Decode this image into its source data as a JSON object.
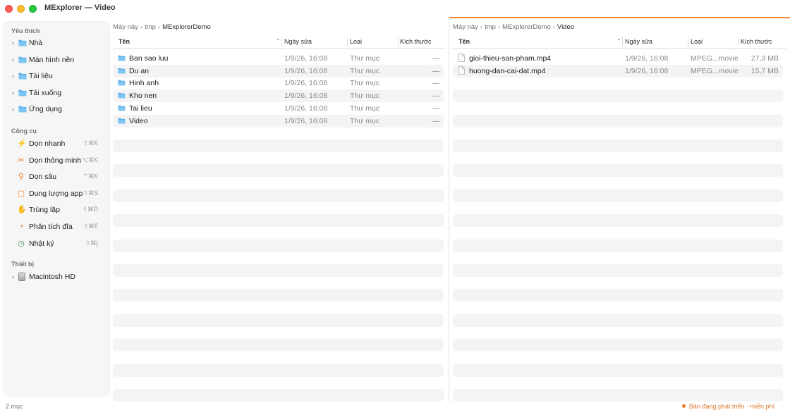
{
  "window": {
    "title": "MExplorer — Video"
  },
  "sidebar": {
    "favorites_title": "Yêu thích",
    "favorites": [
      {
        "label": "Nhà",
        "icon": "folder-home-icon"
      },
      {
        "label": "Màn hình nền",
        "icon": "folder-desktop-icon"
      },
      {
        "label": "Tài liệu",
        "icon": "folder-documents-icon"
      },
      {
        "label": "Tải xuống",
        "icon": "folder-downloads-icon"
      },
      {
        "label": "Ứng dụng",
        "icon": "folder-applications-icon"
      }
    ],
    "tools_title": "Công cụ",
    "tools": [
      {
        "label": "Dọn nhanh",
        "shortcut": "⇧⌘K",
        "icon": "bolt-icon",
        "color": "#f07a24"
      },
      {
        "label": "Dọn thông minh",
        "shortcut": "⌥⌘K",
        "icon": "magic-wand-icon",
        "color": "#f07a24"
      },
      {
        "label": "Dọn sâu",
        "shortcut": "^⌘K",
        "icon": "magnifier-icon",
        "color": "#f07a24"
      },
      {
        "label": "Dung lượng app",
        "shortcut": "⇧⌘S",
        "icon": "app-size-icon",
        "color": "#f07a24"
      },
      {
        "label": "Trùng lặp",
        "shortcut": "⇧⌘D",
        "icon": "duplicate-icon",
        "color": "#f07a24"
      },
      {
        "label": "Phân tích đĩa",
        "shortcut": "⇧⌘E",
        "icon": "disk-analysis-icon",
        "color": "#f07a24"
      },
      {
        "label": "Nhật ký",
        "shortcut": "⇧⌘J",
        "icon": "history-icon",
        "color": "#3a8a5a"
      }
    ],
    "devices_title": "Thiết bị",
    "devices": [
      {
        "label": "Macintosh HD",
        "icon": "hard-drive-icon"
      }
    ]
  },
  "left_pane": {
    "breadcrumb": [
      "Máy này",
      "tmp",
      "MExplorerDemo"
    ],
    "columns": {
      "name": "Tên",
      "date": "Ngày sửa",
      "kind": "Loại",
      "size": "Kích thước"
    },
    "rows": [
      {
        "name": "Ban sao luu",
        "date": "1/9/26, 16:08",
        "kind": "Thư mục",
        "size": "—",
        "icon": "folder-icon"
      },
      {
        "name": "Du an",
        "date": "1/9/26, 16:08",
        "kind": "Thư mục",
        "size": "—",
        "icon": "folder-icon"
      },
      {
        "name": "Hinh anh",
        "date": "1/9/26, 16:08",
        "kind": "Thư mục",
        "size": "—",
        "icon": "folder-icon"
      },
      {
        "name": "Kho nen",
        "date": "1/9/26, 16:08",
        "kind": "Thư mục",
        "size": "—",
        "icon": "folder-icon"
      },
      {
        "name": "Tai lieu",
        "date": "1/9/26, 16:08",
        "kind": "Thư mục",
        "size": "—",
        "icon": "folder-icon"
      },
      {
        "name": "Video",
        "date": "1/9/26, 16:08",
        "kind": "Thư mục",
        "size": "—",
        "icon": "folder-icon"
      }
    ]
  },
  "right_pane": {
    "breadcrumb": [
      "Máy này",
      "tmp",
      "MExplorerDemo",
      "Video"
    ],
    "columns": {
      "name": "Tên",
      "date": "Ngày sửa",
      "kind": "Loại",
      "size": "Kích thước"
    },
    "rows": [
      {
        "name": "gioi-thieu-san-pham.mp4",
        "date": "1/9/26, 16:08",
        "kind": "MPEG...movie",
        "size": "27,3 MB",
        "icon": "video-file-icon"
      },
      {
        "name": "huong-dan-cai-dat.mp4",
        "date": "1/9/26, 16:08",
        "kind": "MPEG...movie",
        "size": "15,7 MB",
        "icon": "video-file-icon"
      }
    ]
  },
  "status": {
    "item_count": "2 mục",
    "dev_notice": "Bản đang phát triển · miễn phí"
  },
  "colors": {
    "accent": "#f07a24",
    "folder": "#5aaee6",
    "stripe": "#f4f4f4"
  }
}
